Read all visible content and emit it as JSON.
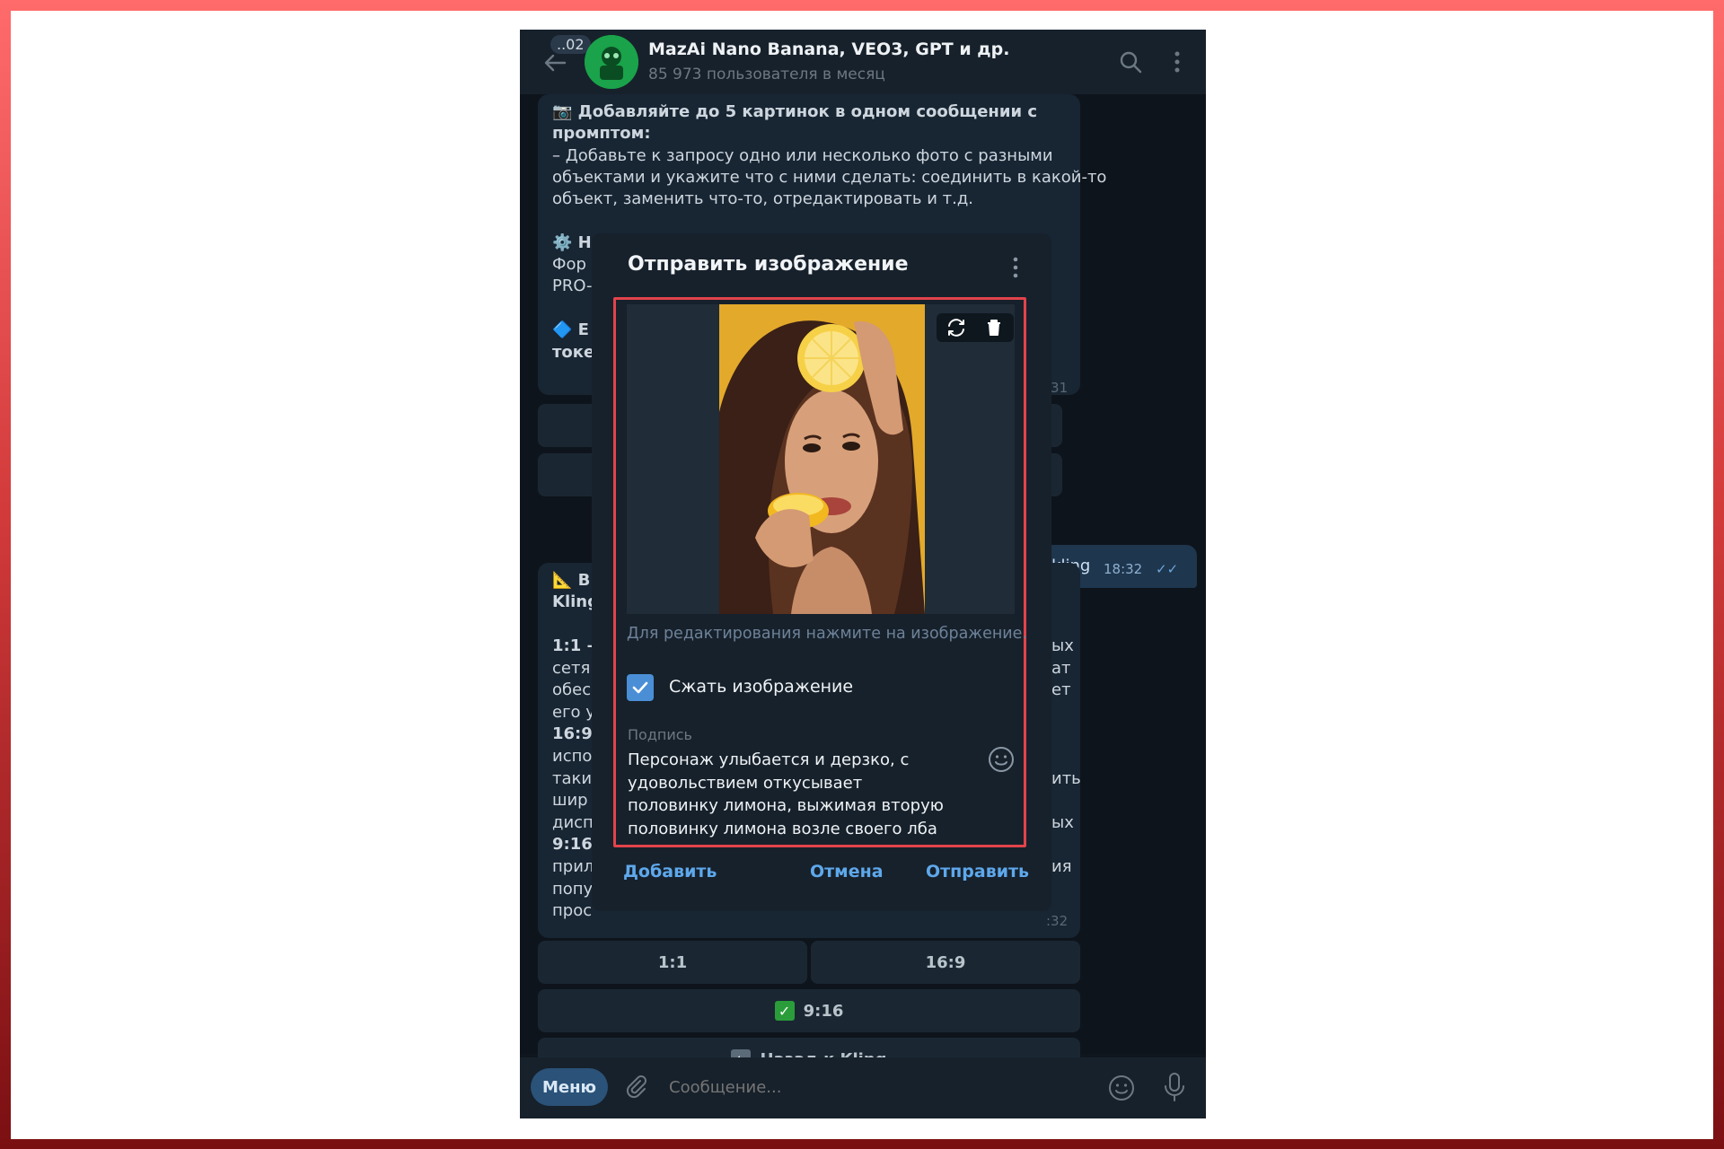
{
  "header": {
    "unread": "..02",
    "title": "MazAi Nano Banana, VEO3, GPT и др.",
    "subtitle": "85 973 пользователя в месяц"
  },
  "messages": {
    "m1_line1": "📷 Добавляйте до 5 картинок в одном сообщении с",
    "m1_line2": "промптом:",
    "m1_line3": "– Добавьте к запросу одно или несколько фото с разными",
    "m1_line4": "объектами и укажите что с ними сделать: соединить в какой-то",
    "m1_line5": "объект, заменить что-то, отредактировать и т.д.",
    "m1_frag1": "⚙️ Н",
    "m1_frag2": "Фор",
    "m1_frag3": "PRO-",
    "m1_frag4": "🔷 Е",
    "m1_frag5": "токе",
    "m1_time": ":31",
    "out_text": "/kling",
    "out_time": "18:32",
    "m2_frag1": "📐 В",
    "m2_frag2": "Kling",
    "m2_left": [
      "1:1 –",
      "сетя",
      "обес",
      "его у",
      "16:9",
      "испо",
      "таки",
      "шир",
      "дисп",
      "9:16",
      "прил",
      "попу",
      "прос"
    ],
    "m2_right": [
      "ых",
      "ат",
      "ет",
      "",
      "",
      "",
      "ить",
      "",
      "ых",
      "",
      "ия",
      ":32"
    ]
  },
  "keyboard": {
    "btn_1_1": "1:1",
    "btn_16_9": "16:9",
    "btn_9_16": "9:16",
    "btn_back": "Назад к Kling"
  },
  "input": {
    "menu": "Меню",
    "placeholder": "Сообщение..."
  },
  "modal": {
    "title": "Отправить изображение",
    "hint": "Для редактирования нажмите на изображение.",
    "compress_label": "Сжать изображение",
    "compress_checked": true,
    "caption_label": "Подпись",
    "caption_value": "Персонаж улыбается и дерзко, с удовольствием откусывает половинку лимона, выжимая вторую половинку лимона возле своего лба",
    "add": "Добавить",
    "cancel": "Отмена",
    "send": "Отправить"
  },
  "colors": {
    "accent": "#5ea8ec",
    "highlight": "#e2434b",
    "checkbox": "#4a8fd6"
  }
}
